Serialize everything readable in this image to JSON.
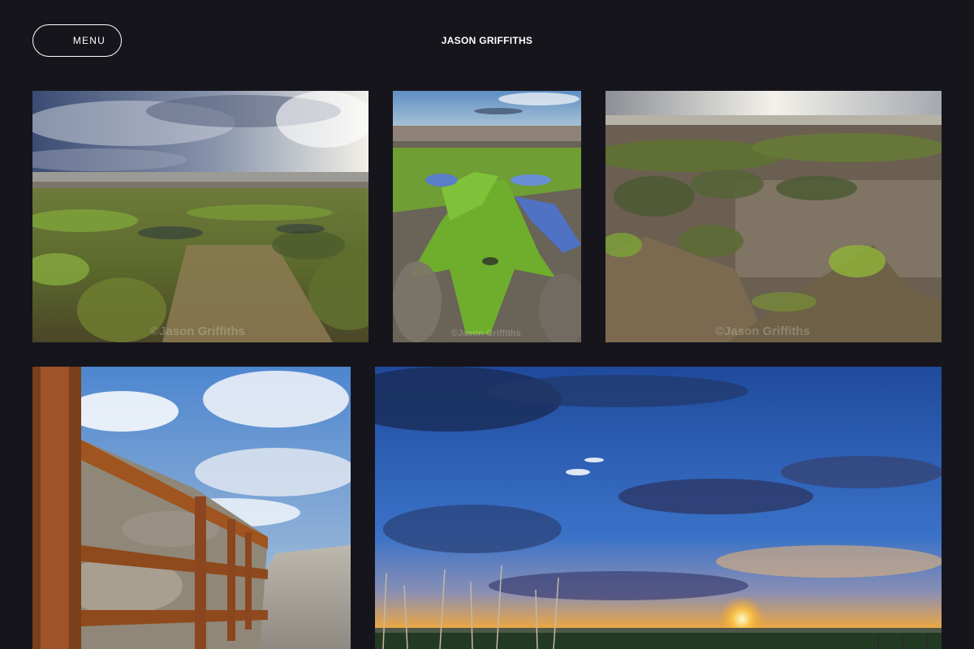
{
  "header": {
    "menu_label": "MENU",
    "site_title": "JASON GRIFFITHS"
  },
  "gallery": {
    "photos": [
      {
        "subject": "mossy rocks on beach under stormy sky",
        "watermark": "©Jason Griffiths"
      },
      {
        "subject": "green moss covered rock channel with tide pools",
        "watermark": "©Jason Griffiths"
      },
      {
        "subject": "moss covered rock shelves at low tide",
        "watermark": "©Jason Griffiths"
      },
      {
        "subject": "rusted iron fence along pebble beach",
        "watermark": ""
      },
      {
        "subject": "sunset over field with dramatic blue clouds",
        "watermark": ""
      }
    ]
  },
  "colors": {
    "background": "#16151c",
    "text": "#ffffff"
  }
}
